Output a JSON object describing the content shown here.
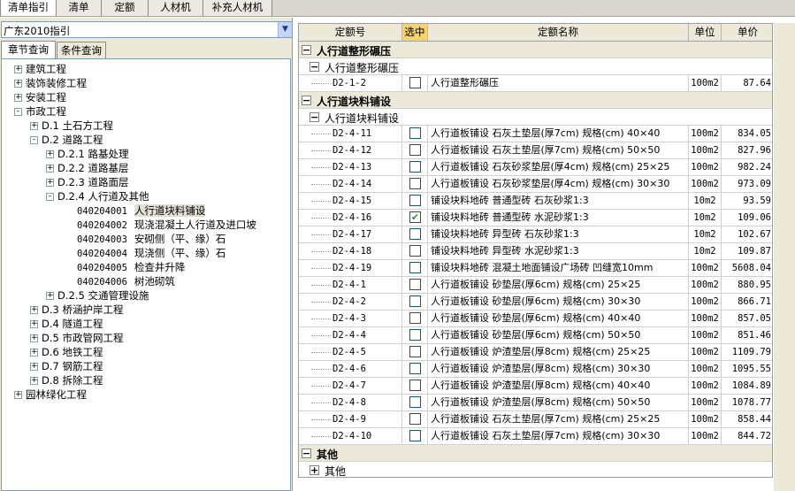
{
  "top_tabs": [
    "清单指引",
    "清单",
    "定额",
    "人材机",
    "补充人材机"
  ],
  "left": {
    "combo_value": "广东2010指引",
    "sub_tabs": [
      "章节查询",
      "条件查询"
    ],
    "tree": [
      {
        "label": "建筑工程",
        "level": 0,
        "pm": "+"
      },
      {
        "label": "装饰装修工程",
        "level": 0,
        "pm": "+"
      },
      {
        "label": "安装工程",
        "level": 0,
        "pm": "+"
      },
      {
        "label": "市政工程",
        "level": 0,
        "pm": "-"
      },
      {
        "label": "D.1 土石方工程",
        "level": 1,
        "pm": "+"
      },
      {
        "label": "D.2 道路工程",
        "level": 1,
        "pm": "-"
      },
      {
        "label": "D.2.1 路基处理",
        "level": 2,
        "pm": "+"
      },
      {
        "label": "D.2.2 道路基层",
        "level": 2,
        "pm": "+"
      },
      {
        "label": "D.2.3 道路面层",
        "level": 2,
        "pm": "+"
      },
      {
        "label": "D.2.4 人行道及其他",
        "level": 2,
        "pm": "-"
      },
      {
        "code": "040204001",
        "label": "人行道块料铺设",
        "level": 3,
        "selected": true
      },
      {
        "code": "040204002",
        "label": "现浇混凝土人行道及进口坡",
        "level": 3
      },
      {
        "code": "040204003",
        "label": "安砌侧（平、缘）石",
        "level": 3
      },
      {
        "code": "040204004",
        "label": "现浇侧（平、缘）石",
        "level": 3
      },
      {
        "code": "040204005",
        "label": "检查井升降",
        "level": 3
      },
      {
        "code": "040204006",
        "label": "树池砌筑",
        "level": 3
      },
      {
        "label": "D.2.5 交通管理设施",
        "level": 2,
        "pm": "+"
      },
      {
        "label": "D.3 桥涵护岸工程",
        "level": 1,
        "pm": "+"
      },
      {
        "label": "D.4 隧道工程",
        "level": 1,
        "pm": "+"
      },
      {
        "label": "D.5 市政管网工程",
        "level": 1,
        "pm": "+"
      },
      {
        "label": "D.6 地铁工程",
        "level": 1,
        "pm": "+"
      },
      {
        "label": "D.7 钢筋工程",
        "level": 1,
        "pm": "+"
      },
      {
        "label": "D.8 拆除工程",
        "level": 1,
        "pm": "+"
      },
      {
        "label": "园林绿化工程",
        "level": 0,
        "pm": "+"
      }
    ]
  },
  "grid": {
    "headers": [
      "定额号",
      "选中",
      "定额名称",
      "单位",
      "单价"
    ],
    "rows": [
      {
        "type": "group1",
        "label": "人行道整形碾压",
        "pm": "-"
      },
      {
        "type": "group2",
        "label": "人行道整形碾压",
        "pm": "-"
      },
      {
        "type": "item",
        "code": "D2-1-2",
        "checked": false,
        "name": "人行道整形碾压",
        "unit": "100m2",
        "price": "87.64"
      },
      {
        "type": "group1",
        "label": "人行道块料铺设",
        "pm": "-"
      },
      {
        "type": "group2",
        "label": "人行道块料铺设",
        "pm": "-"
      },
      {
        "type": "item",
        "code": "D2-4-11",
        "checked": false,
        "name": "人行道板铺设 石灰土垫层(厚7cm) 规格(cm) 40×40",
        "unit": "100m2",
        "price": "834.05"
      },
      {
        "type": "item",
        "code": "D2-4-12",
        "checked": false,
        "name": "人行道板铺设 石灰土垫层(厚7cm) 规格(cm) 50×50",
        "unit": "100m2",
        "price": "827.96"
      },
      {
        "type": "item",
        "code": "D2-4-13",
        "checked": false,
        "name": "人行道板铺设 石灰砂浆垫层(厚4cm) 规格(cm) 25×25",
        "unit": "100m2",
        "price": "982.24"
      },
      {
        "type": "item",
        "code": "D2-4-14",
        "checked": false,
        "name": "人行道板铺设 石灰砂浆垫层(厚4cm) 规格(cm) 30×30",
        "unit": "100m2",
        "price": "973.09"
      },
      {
        "type": "item",
        "code": "D2-4-15",
        "checked": false,
        "name": "铺设块料地砖 普通型砖 石灰砂浆1:3",
        "unit": "10m2",
        "price": "93.59"
      },
      {
        "type": "item",
        "code": "D2-4-16",
        "checked": true,
        "name": "铺设块料地砖 普通型砖 水泥砂浆1:3",
        "unit": "10m2",
        "price": "109.06"
      },
      {
        "type": "item",
        "code": "D2-4-17",
        "checked": false,
        "name": "铺设块料地砖 异型砖 石灰砂浆1:3",
        "unit": "10m2",
        "price": "102.67"
      },
      {
        "type": "item",
        "code": "D2-4-18",
        "checked": false,
        "name": "铺设块料地砖 异型砖 水泥砂浆1:3",
        "unit": "10m2",
        "price": "109.87"
      },
      {
        "type": "item",
        "code": "D2-4-19",
        "checked": false,
        "name": "铺设块料地砖 混凝土地面铺设广场砖 凹缝宽10mm",
        "unit": "100m2",
        "price": "5608.04"
      },
      {
        "type": "item",
        "code": "D2-4-1",
        "checked": false,
        "name": "人行道板铺设 砂垫层(厚6cm) 规格(cm) 25×25",
        "unit": "100m2",
        "price": "880.95"
      },
      {
        "type": "item",
        "code": "D2-4-2",
        "checked": false,
        "name": "人行道板铺设 砂垫层(厚6cm) 规格(cm) 30×30",
        "unit": "100m2",
        "price": "866.71"
      },
      {
        "type": "item",
        "code": "D2-4-3",
        "checked": false,
        "name": "人行道板铺设 砂垫层(厚6cm) 规格(cm) 40×40",
        "unit": "100m2",
        "price": "857.05"
      },
      {
        "type": "item",
        "code": "D2-4-4",
        "checked": false,
        "name": "人行道板铺设 砂垫层(厚6cm) 规格(cm) 50×50",
        "unit": "100m2",
        "price": "851.46"
      },
      {
        "type": "item",
        "code": "D2-4-5",
        "checked": false,
        "name": "人行道板铺设 炉渣垫层(厚8cm) 规格(cm) 25×25",
        "unit": "100m2",
        "price": "1109.79"
      },
      {
        "type": "item",
        "code": "D2-4-6",
        "checked": false,
        "name": "人行道板铺设 炉渣垫层(厚8cm) 规格(cm) 30×30",
        "unit": "100m2",
        "price": "1095.55"
      },
      {
        "type": "item",
        "code": "D2-4-7",
        "checked": false,
        "name": "人行道板铺设 炉渣垫层(厚8cm) 规格(cm) 40×40",
        "unit": "100m2",
        "price": "1084.89"
      },
      {
        "type": "item",
        "code": "D2-4-8",
        "checked": false,
        "name": "人行道板铺设 炉渣垫层(厚8cm) 规格(cm) 50×50",
        "unit": "100m2",
        "price": "1078.77"
      },
      {
        "type": "item",
        "code": "D2-4-9",
        "checked": false,
        "name": "人行道板铺设 石灰土垫层(厚7cm) 规格(cm) 25×25",
        "unit": "100m2",
        "price": "858.44"
      },
      {
        "type": "item",
        "code": "D2-4-10",
        "checked": false,
        "name": "人行道板铺设 石灰土垫层(厚7cm) 规格(cm) 30×30",
        "unit": "100m2",
        "price": "844.72"
      },
      {
        "type": "group1",
        "label": "其他",
        "pm": "-"
      },
      {
        "type": "group2",
        "label": "其他",
        "pm": "+"
      }
    ]
  }
}
